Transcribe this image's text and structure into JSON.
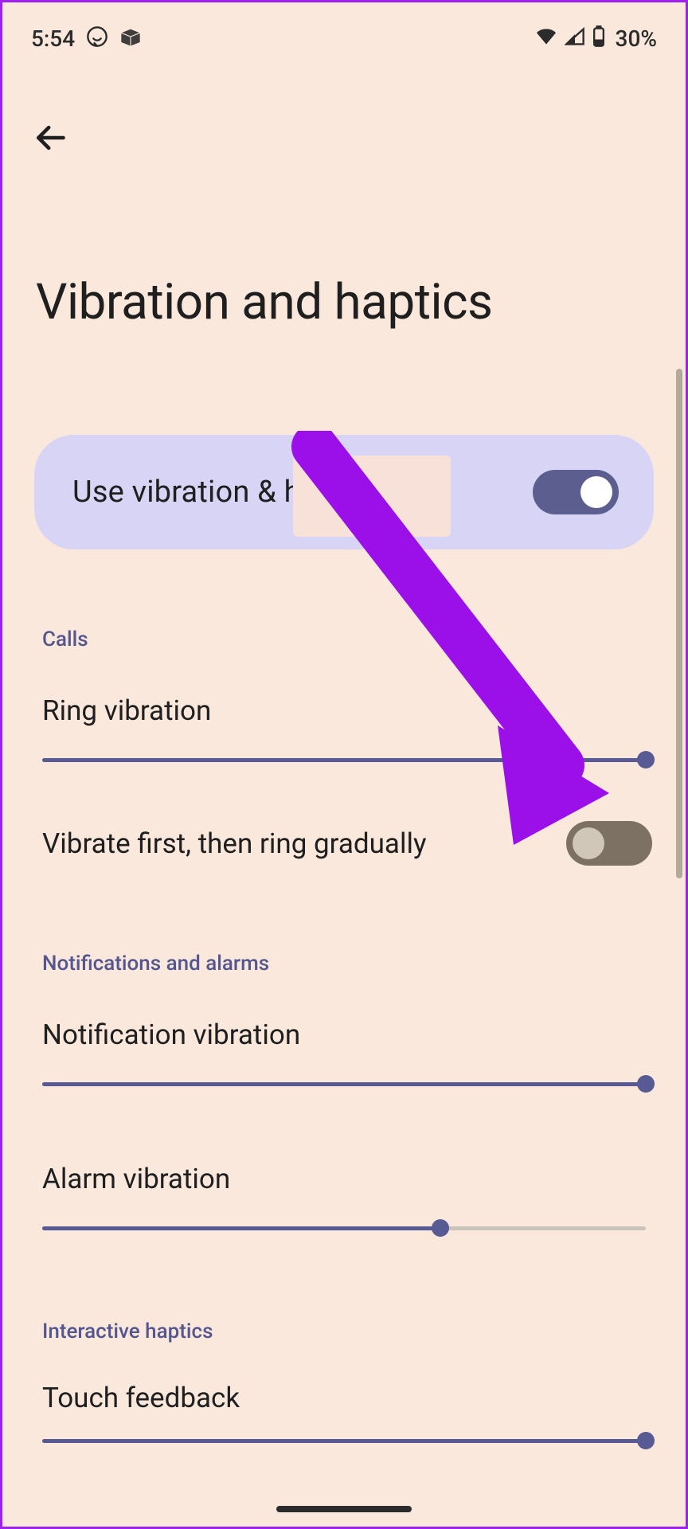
{
  "statusbar": {
    "time": "5:54",
    "battery": "30%"
  },
  "header": {
    "title": "Vibration and haptics"
  },
  "mainToggle": {
    "label": "Use vibration & haptics",
    "on": true
  },
  "sections": {
    "calls": {
      "header": "Calls",
      "ringVibration": {
        "label": "Ring vibration",
        "value": 100
      },
      "vibrateFirst": {
        "label": "Vibrate first, then ring gradually",
        "on": false
      }
    },
    "notifications": {
      "header": "Notifications and alarms",
      "notificationVibration": {
        "label": "Notification vibration",
        "value": 100
      },
      "alarmVibration": {
        "label": "Alarm vibration",
        "value": 66
      }
    },
    "interactive": {
      "header": "Interactive haptics",
      "touchFeedback": {
        "label": "Touch feedback",
        "value": 100
      }
    }
  }
}
